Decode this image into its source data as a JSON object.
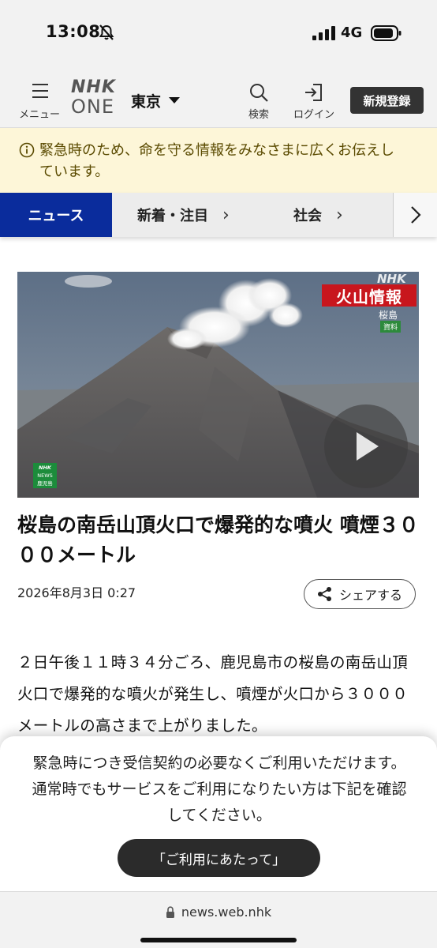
{
  "status_bar": {
    "time": "13:08",
    "network": "4G",
    "icons": [
      "bell-slash-icon",
      "signal-icon",
      "battery-icon"
    ]
  },
  "header": {
    "menu_label": "メニュー",
    "logo": "NHK ONE",
    "region": "東京",
    "search_label": "検索",
    "login_label": "ログイン",
    "register_label": "新規登録"
  },
  "notice": {
    "text": "緊急時のため、命を守る情報をみなさまに広くお伝えしています。",
    "icon": "info-icon"
  },
  "nav": {
    "active": "ニュース",
    "items": [
      {
        "label": "新着・注目"
      },
      {
        "label": "社会"
      }
    ]
  },
  "article": {
    "image_overlay_title": "火山情報",
    "image_overlay_sub": "桜島",
    "image_overlay_tag": "資料",
    "image_watermark": "NHK",
    "image_badge_top": "NHK",
    "image_badge_mid": "NEWS",
    "image_badge_bot": "鹿児島",
    "headline": "桜島の南岳山頂火口で爆発的な噴火 噴煙３０００メートル",
    "timestamp": "2026年8月3日 0:27",
    "share_label": "シェアする",
    "body": "２日午後１１時３４分ごろ、鹿児島市の桜島の南岳山頂火口で爆発的な噴火が発生し、噴煙が火口から３０００メートルの高さまで上がりました。"
  },
  "sheet": {
    "text": "緊急時につき受信契約の必要なくご利用いただけます。通常時でもサービスをご利用になりたい方は下記を確認してください。",
    "button_label": "「ご利用にあたって」"
  },
  "browser": {
    "url": "news.web.nhk"
  },
  "colors": {
    "nav_active": "#0a2c9c",
    "notice_bg": "#fdf6d8",
    "overlay_red": "#c8161d"
  }
}
